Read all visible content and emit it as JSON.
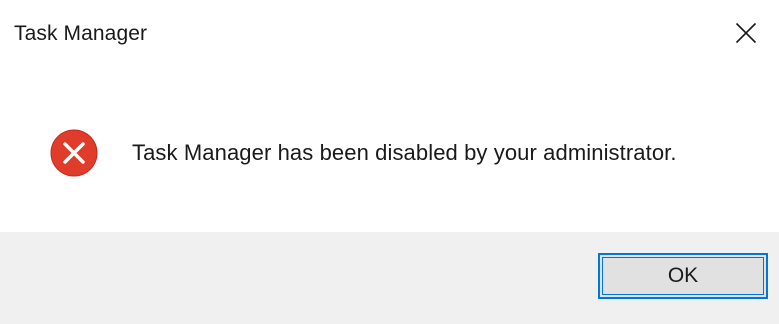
{
  "window": {
    "title": "Task Manager",
    "close_icon": "close-icon"
  },
  "content": {
    "icon": "error-icon",
    "message": "Task Manager has been disabled by your administrator."
  },
  "footer": {
    "ok_label": "OK"
  },
  "colors": {
    "error_red": "#e81123",
    "accent_blue": "#0078d7",
    "footer_bg": "#f0f0f0"
  }
}
